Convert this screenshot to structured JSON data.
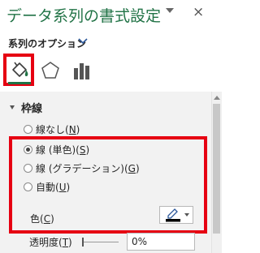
{
  "pane": {
    "title": "データ系列の書式設定",
    "close_glyph": "×"
  },
  "options": {
    "label": "系列のオプション"
  },
  "tabs": [
    {
      "name": "fill-line",
      "icon": "paint-bucket-icon",
      "selected": true
    },
    {
      "name": "effects",
      "icon": "pentagon-icon",
      "selected": false
    },
    {
      "name": "series-options",
      "icon": "bar-chart-icon",
      "selected": false
    }
  ],
  "section": {
    "title": "枠線",
    "expanded": true
  },
  "border": {
    "none": {
      "text": "線なし(",
      "key": "N",
      "end": ")",
      "checked": false
    },
    "solid": {
      "text": "線 (単色)(",
      "key": "S",
      "end": ")",
      "checked": true
    },
    "gradient": {
      "text": "線 (グラデーション)(",
      "key": "G",
      "end": ")",
      "checked": false
    },
    "auto": {
      "text": "自動(",
      "key": "U",
      "end": ")",
      "checked": false
    }
  },
  "color": {
    "text": "色(",
    "key": "C",
    "end": ")",
    "swatch": "#000000",
    "icon": "pen-color-icon"
  },
  "transparency": {
    "text": "透明度(",
    "key": "T",
    "end": ")",
    "value": "0%",
    "level": 0
  },
  "colors": {
    "accent": "#217346",
    "highlight": "#e60012",
    "panel_bg": "#f2f2f2"
  }
}
